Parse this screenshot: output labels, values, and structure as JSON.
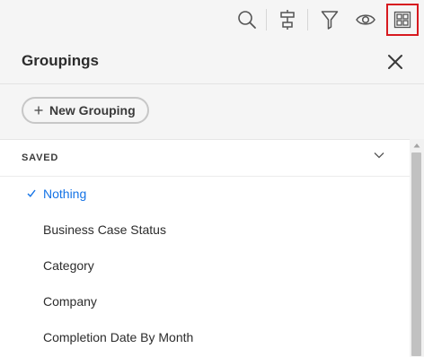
{
  "toolbar": {
    "icons": [
      "search-icon",
      "hierarchy-icon",
      "filter-icon",
      "eye-icon",
      "grid-icon"
    ],
    "active_icon": "grid-icon",
    "active_outline_color": "#d7191f"
  },
  "panel": {
    "title": "Groupings",
    "new_button_label": "New Grouping"
  },
  "saved_section": {
    "label": "SAVED",
    "expanded": true,
    "items": [
      {
        "label": "Nothing",
        "selected": true
      },
      {
        "label": "Business Case Status",
        "selected": false
      },
      {
        "label": "Category",
        "selected": false
      },
      {
        "label": "Company",
        "selected": false
      },
      {
        "label": "Completion Date By Month",
        "selected": false
      }
    ]
  },
  "colors": {
    "accent": "#1473e6",
    "background": "#f5f5f5",
    "list_background": "#ffffff"
  }
}
